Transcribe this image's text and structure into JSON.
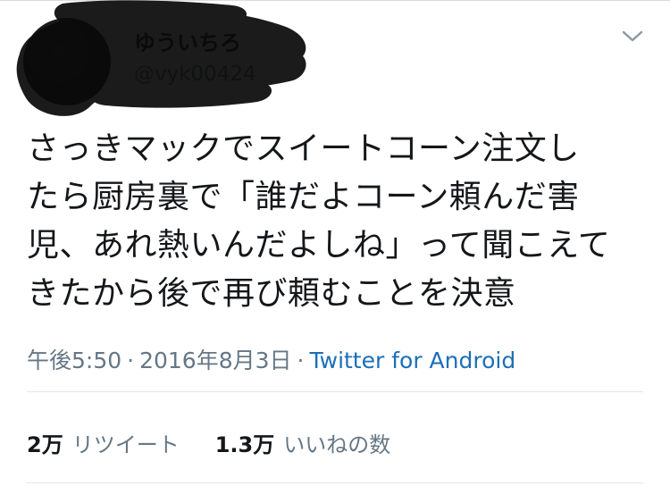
{
  "user": {
    "name": "ゆういちろ",
    "handle": "@vyk00424"
  },
  "tweet": {
    "lines": [
      "さっきマックでスイートコーン注文し",
      "たら厨房裏で「誰だよコーン頼んだ害",
      "児、あれ熱いんだよしね」って聞こえて",
      "きたから後で再び頼むことを決意"
    ],
    "time": "午後5:50",
    "separator": "·",
    "date": "2016年8月3日",
    "source": "Twitter for Android"
  },
  "stats": {
    "retweets_count": "2万",
    "retweets_label": "リツイート",
    "likes_count": "1.3万",
    "likes_label": "いいねの数"
  },
  "icons": {
    "menu": "chevron-down-icon"
  },
  "colors": {
    "text": "#14171a",
    "secondary": "#657786",
    "link": "#1b6fb8",
    "divider": "#e1e8ed"
  }
}
